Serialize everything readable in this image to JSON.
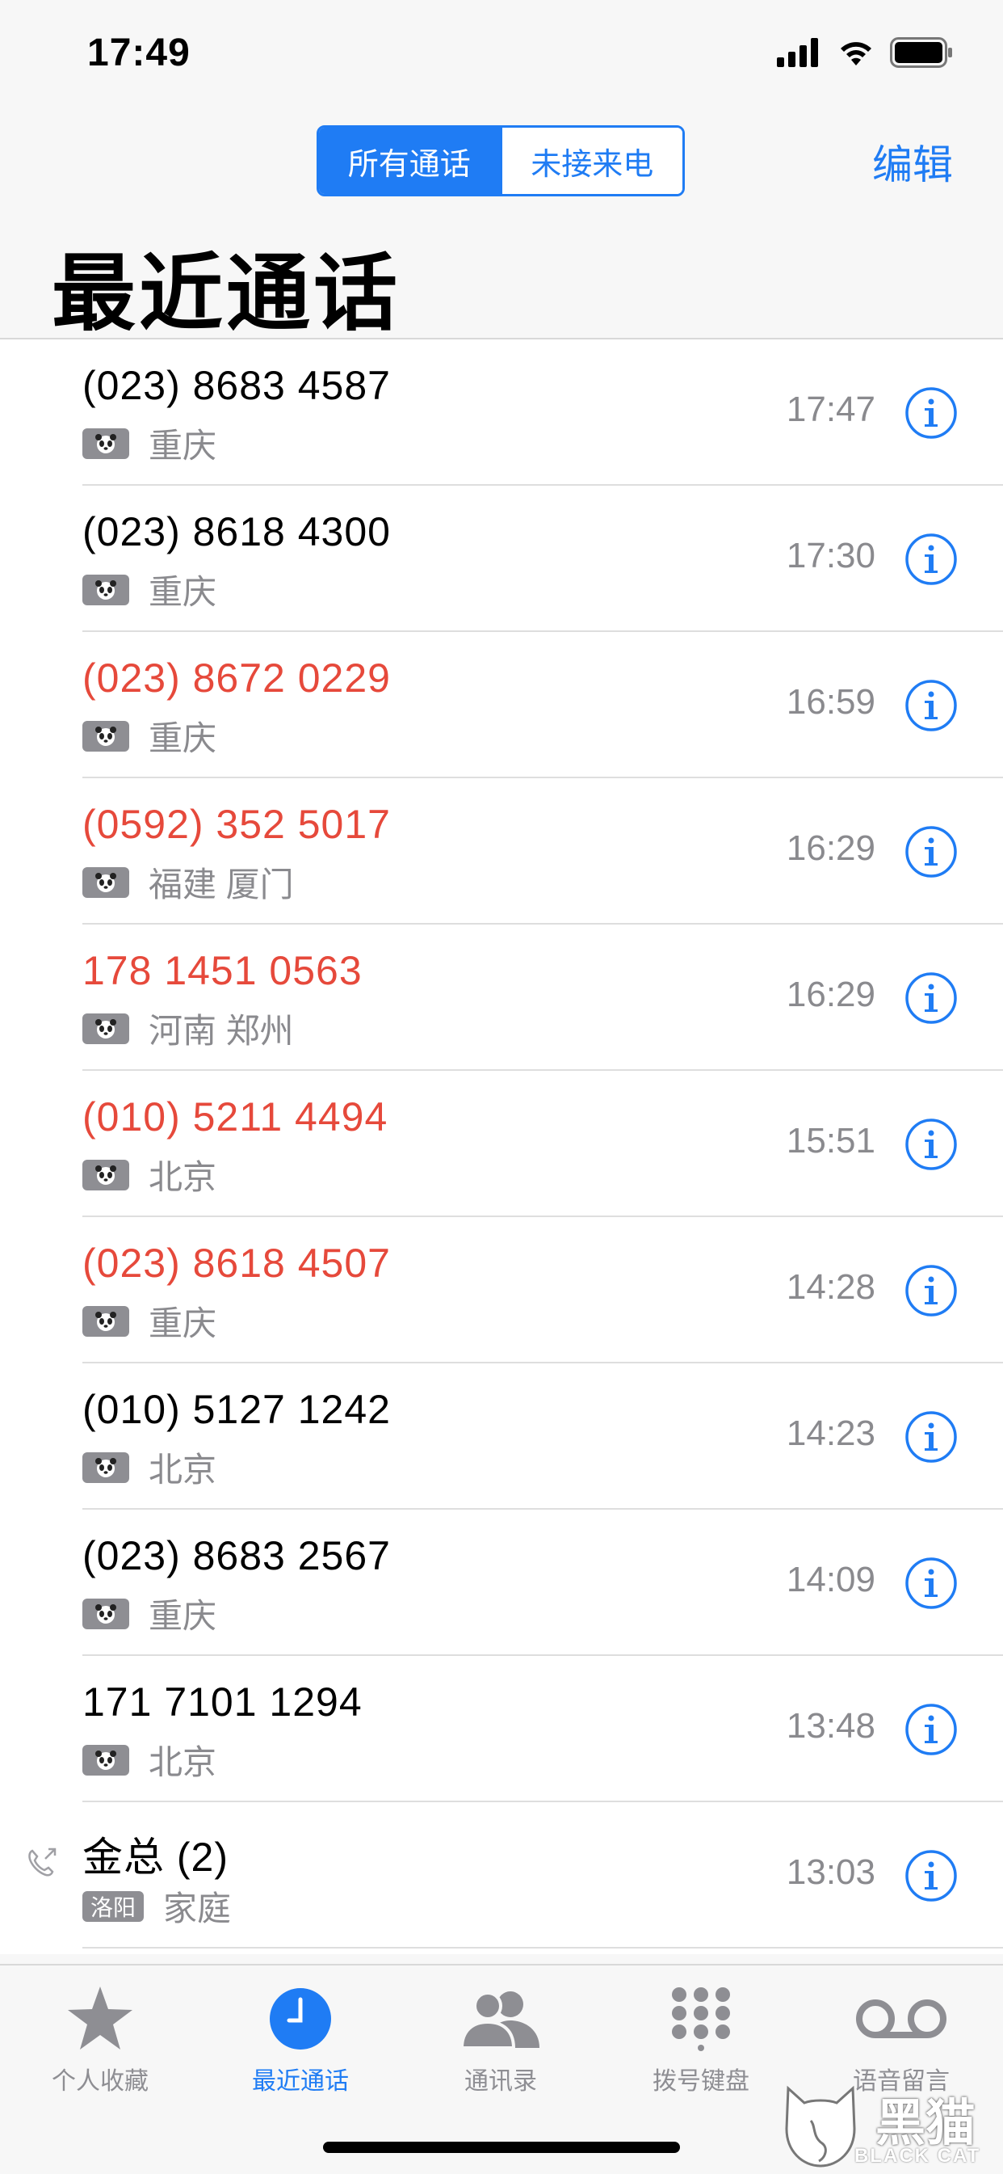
{
  "status": {
    "time": "17:49"
  },
  "nav": {
    "segments": [
      {
        "label": "所有通话",
        "active": true
      },
      {
        "label": "未接来电",
        "active": false
      }
    ],
    "edit": "编辑",
    "title": "最近通话"
  },
  "calls": [
    {
      "number": "(023) 8683 4587",
      "location": "重庆",
      "time": "17:47",
      "missed": false
    },
    {
      "number": "(023) 8618 4300",
      "location": "重庆",
      "time": "17:30",
      "missed": false
    },
    {
      "number": "(023) 8672 0229",
      "location": "重庆",
      "time": "16:59",
      "missed": true
    },
    {
      "number": "(0592) 352 5017",
      "location": "福建 厦门",
      "time": "16:29",
      "missed": true
    },
    {
      "number": "178 1451 0563",
      "location": "河南 郑州",
      "time": "16:29",
      "missed": true
    },
    {
      "number": "(010) 5211 4494",
      "location": "北京",
      "time": "15:51",
      "missed": true
    },
    {
      "number": "(023) 8618 4507",
      "location": "重庆",
      "time": "14:28",
      "missed": true
    },
    {
      "number": "(010) 5127 1242",
      "location": "北京",
      "time": "14:23",
      "missed": false
    },
    {
      "number": "(023) 8683 2567",
      "location": "重庆",
      "time": "14:09",
      "missed": false
    },
    {
      "number": "171 7101 1294",
      "location": "北京",
      "time": "13:48",
      "missed": false
    },
    {
      "number": "金总 (2)",
      "tag": "洛阳",
      "location": "家庭",
      "time": "13:03",
      "missed": false,
      "outgoing": true
    }
  ],
  "tabs": [
    {
      "label": "个人收藏",
      "icon": "star-icon"
    },
    {
      "label": "最近通话",
      "icon": "clock-icon",
      "active": true
    },
    {
      "label": "通讯录",
      "icon": "contacts-icon"
    },
    {
      "label": "拨号键盘",
      "icon": "keypad-icon"
    },
    {
      "label": "语音留言",
      "icon": "voicemail-icon"
    }
  ],
  "watermark": {
    "title": "黑猫",
    "subtitle": "BLACK CAT"
  },
  "colors": {
    "accent": "#1f7cf4",
    "missed": "#e6493b",
    "secondary": "#8a8a8e"
  }
}
